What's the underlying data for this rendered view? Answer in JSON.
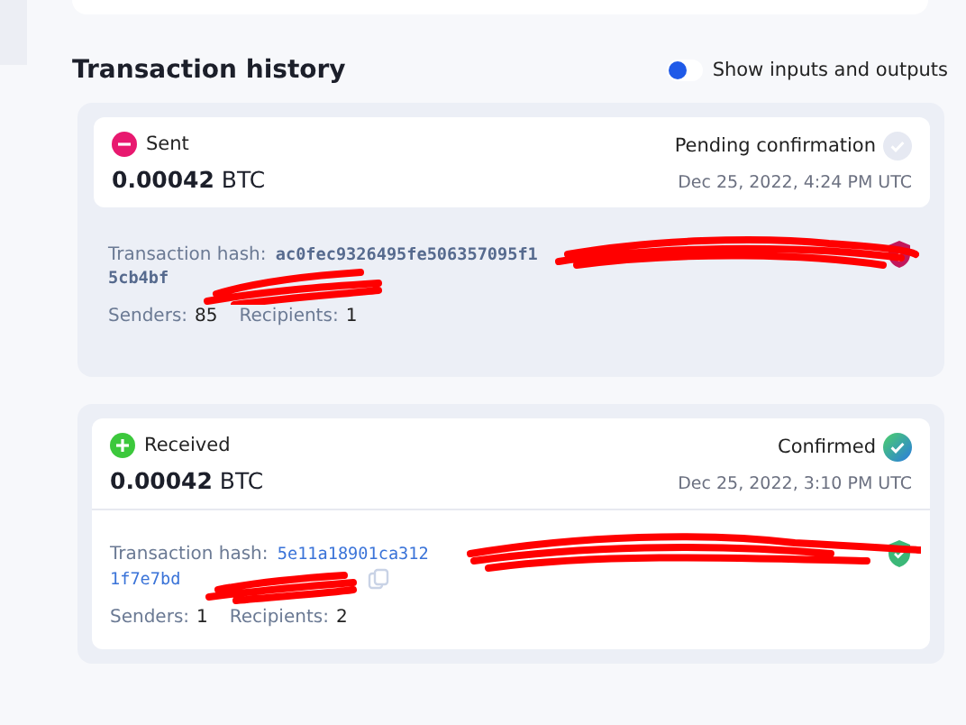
{
  "title": "Transaction history",
  "toggle": {
    "label": "Show inputs and outputs",
    "on": false
  },
  "transactions": [
    {
      "kind": "sent",
      "type_label": "Sent",
      "amount": "0.00042",
      "unit": "BTC",
      "status": {
        "kind": "pending",
        "label": "Pending confirmation"
      },
      "date": "Dec 25, 2022, 4:24 PM UTC",
      "hash_label": "Transaction hash:",
      "hash_lines": [
        "ac0fec9326495fe506357095f1",
        "5cb4bf"
      ],
      "senders_label": "Senders:",
      "senders": "85",
      "recipients_label": "Recipients:",
      "recipients": "1"
    },
    {
      "kind": "received",
      "type_label": "Received",
      "amount": "0.00042",
      "unit": "BTC",
      "status": {
        "kind": "confirmed",
        "label": "Confirmed"
      },
      "date": "Dec 25, 2022, 3:10 PM UTC",
      "hash_label": "Transaction hash:",
      "hash_lines": [
        "5e11a18901ca312",
        "1f7e7bd"
      ],
      "senders_label": "Senders:",
      "senders": "1",
      "recipients_label": "Recipients:",
      "recipients": "2"
    }
  ]
}
